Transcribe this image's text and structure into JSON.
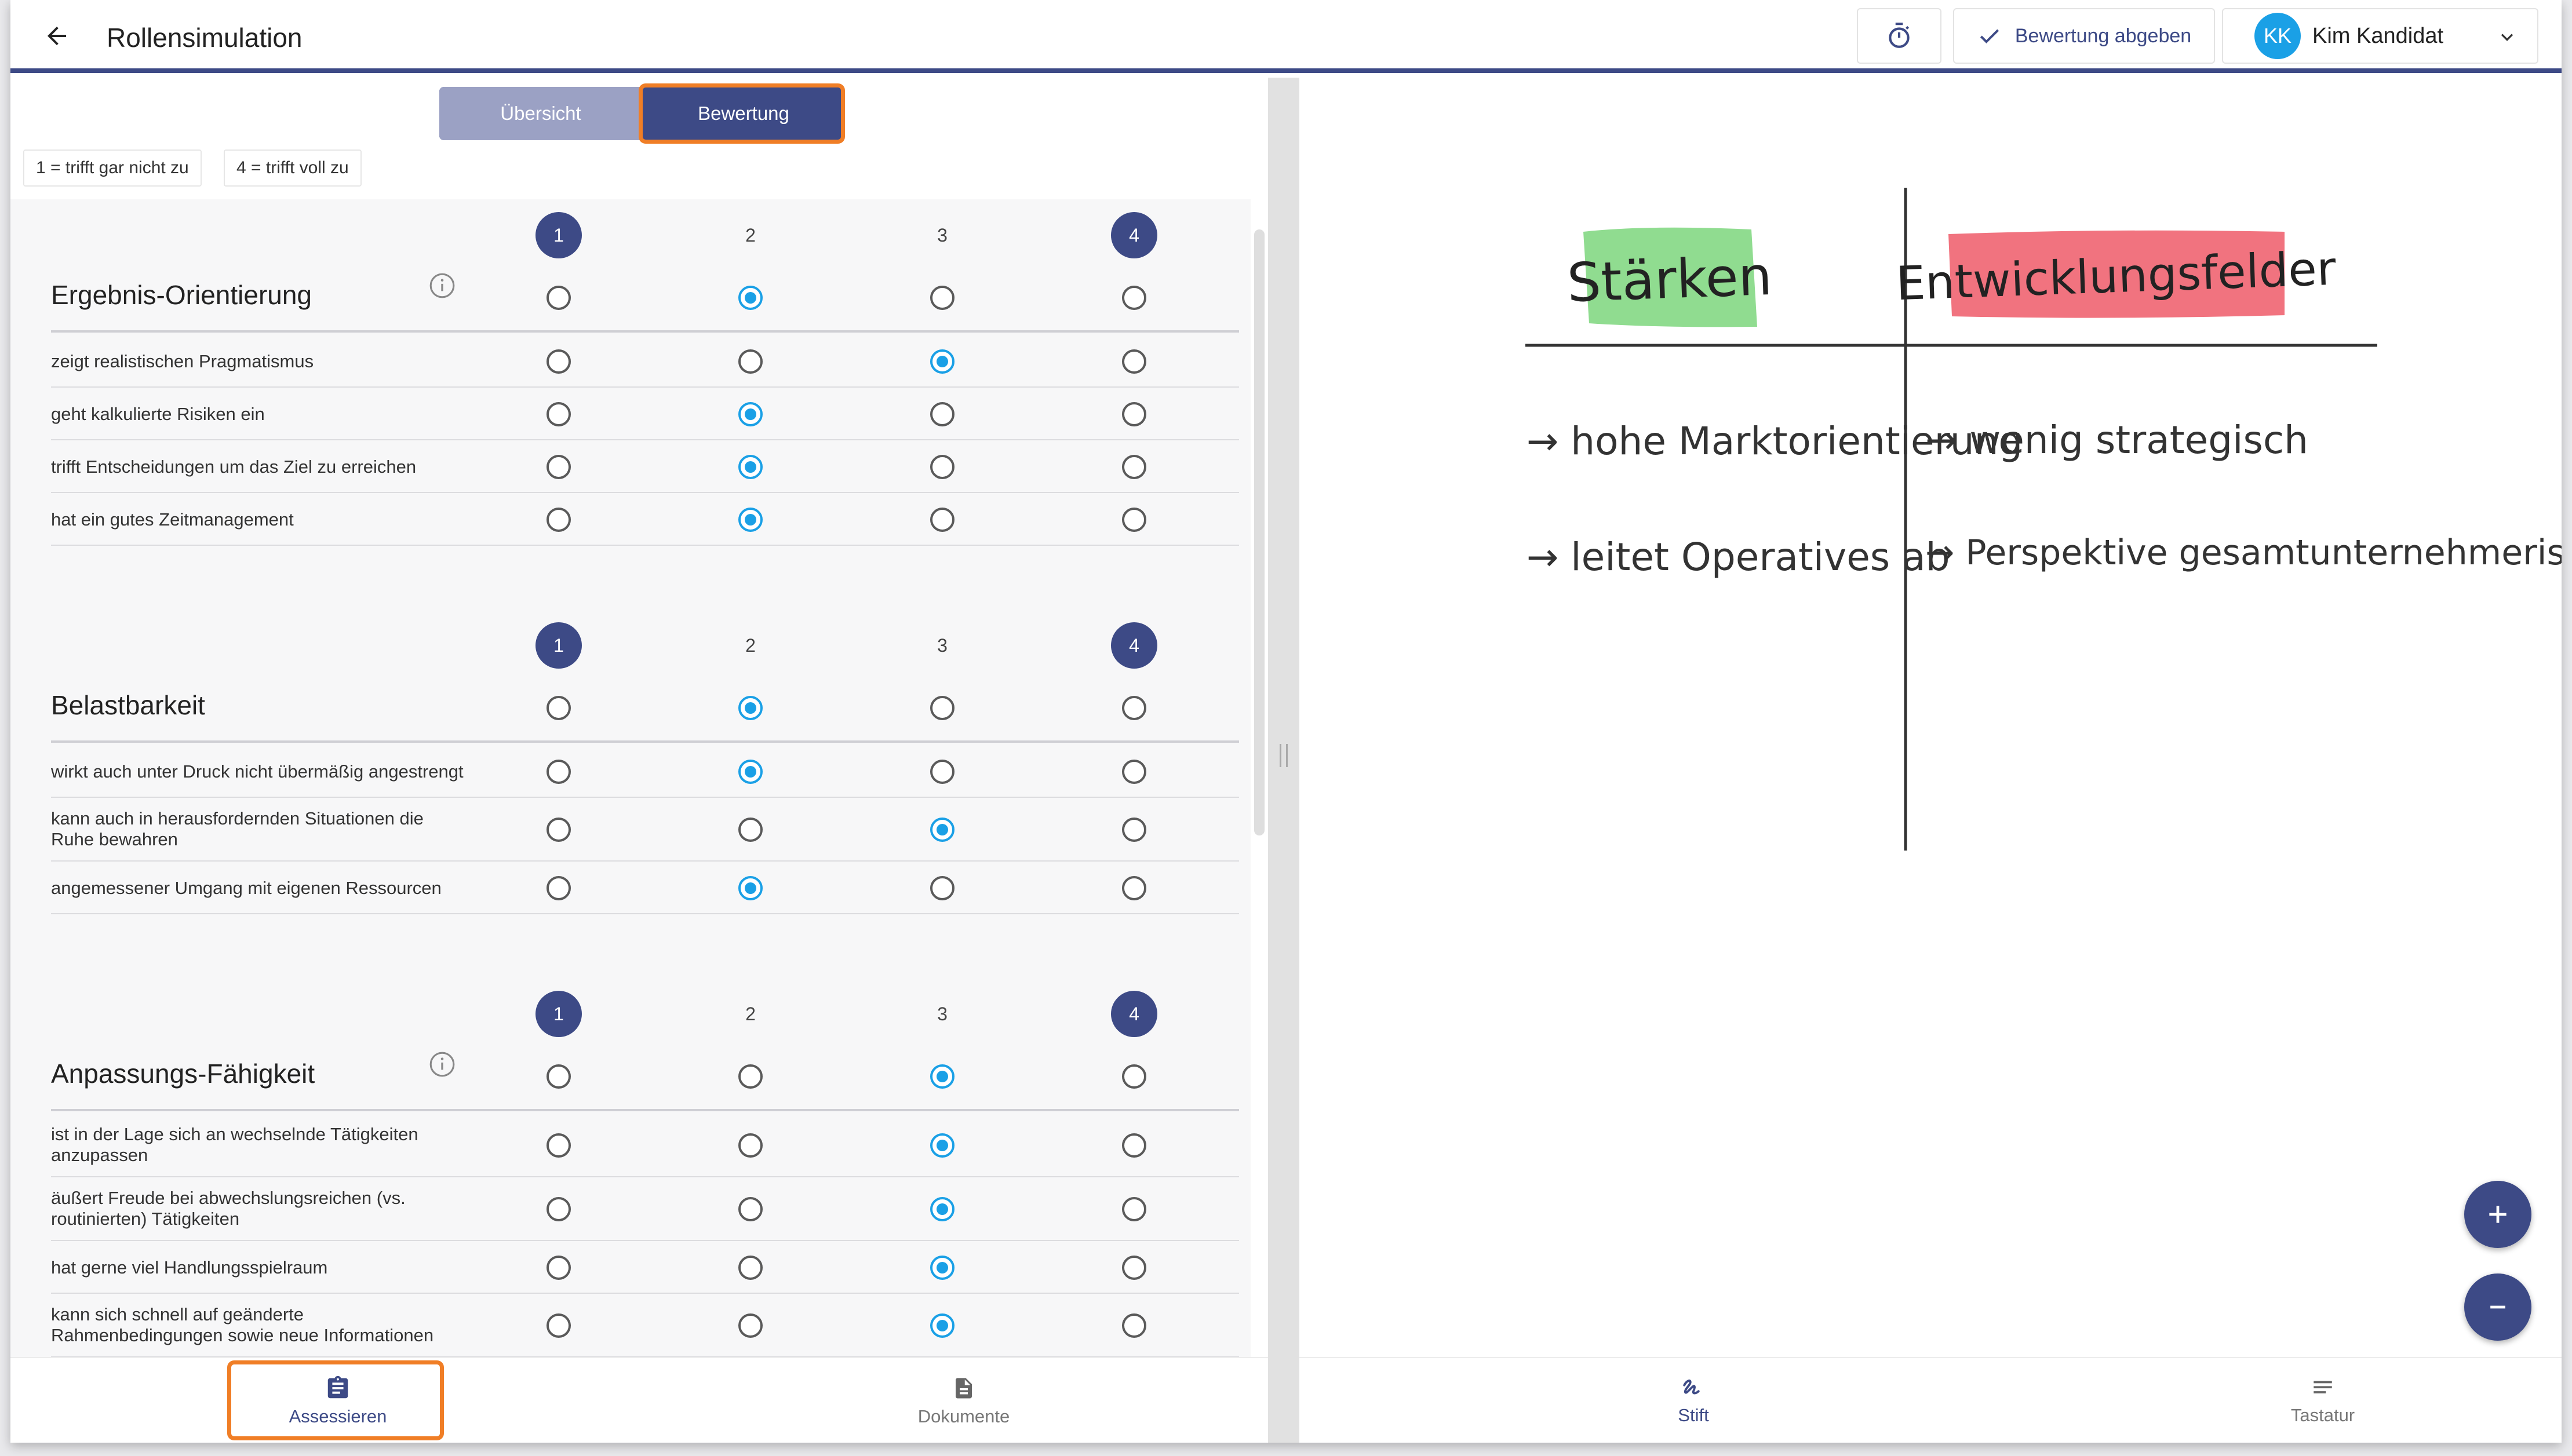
{
  "header": {
    "title": "Rollensimulation",
    "submit_label": "Bewertung abgeben",
    "user": {
      "initials": "KK",
      "name": "Kim Kandidat"
    }
  },
  "tabs": {
    "overview": "Übersicht",
    "rating": "Bewertung"
  },
  "legend": {
    "min": "1 = trifft gar nicht zu",
    "max": "4 = trifft voll zu"
  },
  "scale": [
    "1",
    "2",
    "3",
    "4"
  ],
  "categories": [
    {
      "title": "Ergebnis-Orientierung",
      "has_info": true,
      "selected": 2,
      "items": [
        {
          "label": "zeigt realistischen Pragmatismus",
          "selected": 3
        },
        {
          "label": "geht kalkulierte Risiken ein",
          "selected": 2
        },
        {
          "label": "trifft Entscheidungen um das Ziel zu erreichen",
          "selected": 2
        },
        {
          "label": "hat ein gutes Zeitmanagement",
          "selected": 2
        }
      ]
    },
    {
      "title": "Belastbarkeit",
      "has_info": false,
      "selected": 2,
      "items": [
        {
          "label": "wirkt auch unter Druck nicht übermäßig angestrengt",
          "selected": 2
        },
        {
          "label": "kann auch in herausfordernden Situationen die Ruhe bewahren",
          "selected": 3
        },
        {
          "label": "angemessener Umgang mit eigenen Ressourcen",
          "selected": 2
        }
      ]
    },
    {
      "title": "Anpassungs-Fähigkeit",
      "has_info": true,
      "selected": 3,
      "items": [
        {
          "label": "ist in der Lage sich an wechselnde Tätigkeiten anzupassen",
          "selected": 3
        },
        {
          "label": "äußert Freude bei abwechslungsreichen (vs. routinierten) Tätigkeiten",
          "selected": 3
        },
        {
          "label": "hat gerne viel Handlungsspielraum",
          "selected": 3
        },
        {
          "label": "kann sich schnell auf geänderte Rahmenbedingungen sowie neue Informationen",
          "selected": 3
        }
      ]
    }
  ],
  "bottom_nav_left": {
    "assess": "Assessieren",
    "documents": "Dokumente"
  },
  "bottom_nav_right": {
    "pen": "Stift",
    "keyboard": "Tastatur"
  },
  "whiteboard": {
    "strengths_title": "Stärken",
    "development_title": "Entwicklungsfelder",
    "strengths": [
      "→ hohe Marktorientierung",
      "→ leitet Operatives ab"
    ],
    "development": [
      "→ wenig strategisch",
      "→ Perspektive gesamtunternehmerisch?"
    ],
    "strengths_color": "#7cd67c",
    "development_color": "#ef5b68"
  },
  "colors": {
    "primary": "#3d4a86",
    "accent": "#1aa0e6",
    "highlight": "#f07e26"
  }
}
